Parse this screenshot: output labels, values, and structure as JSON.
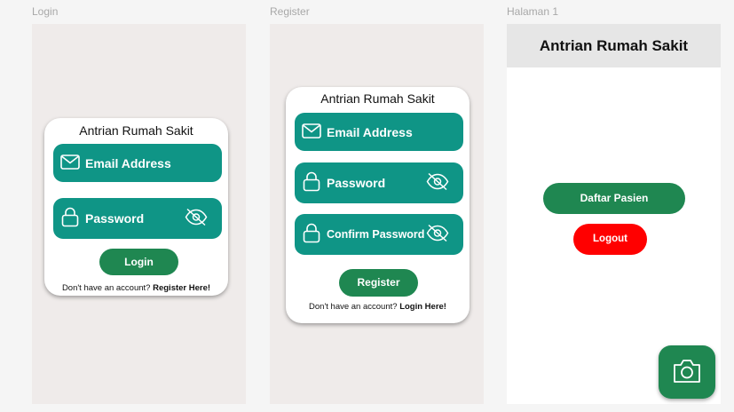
{
  "frames": {
    "login": "Login",
    "register": "Register",
    "halaman": "Halaman 1"
  },
  "login": {
    "title": "Antrian Rumah Sakit",
    "email_label": "Email Address",
    "password_label": "Password",
    "button": "Login",
    "footer_prefix": "Don't have an account?",
    "footer_link": "Register Here!"
  },
  "register": {
    "title": "Antrian Rumah Sakit",
    "email_label": "Email Address",
    "password_label": "Password",
    "confirm_label": "Confirm Password",
    "button": "Register",
    "footer_prefix": "Don't have an account?",
    "footer_link": "Login Here!"
  },
  "halaman": {
    "title": "Antrian Rumah Sakit",
    "daftar_button": "Daftar Pasien",
    "logout_button": "Logout"
  },
  "icons": {
    "email": "envelope-icon",
    "password": "lock-icon",
    "visibility": "eye-off-icon",
    "camera": "camera-icon"
  },
  "colors": {
    "field": "#0f9586",
    "button_primary": "#1f8751",
    "button_logout": "#ff0000",
    "frame_bg": "#efebea"
  }
}
